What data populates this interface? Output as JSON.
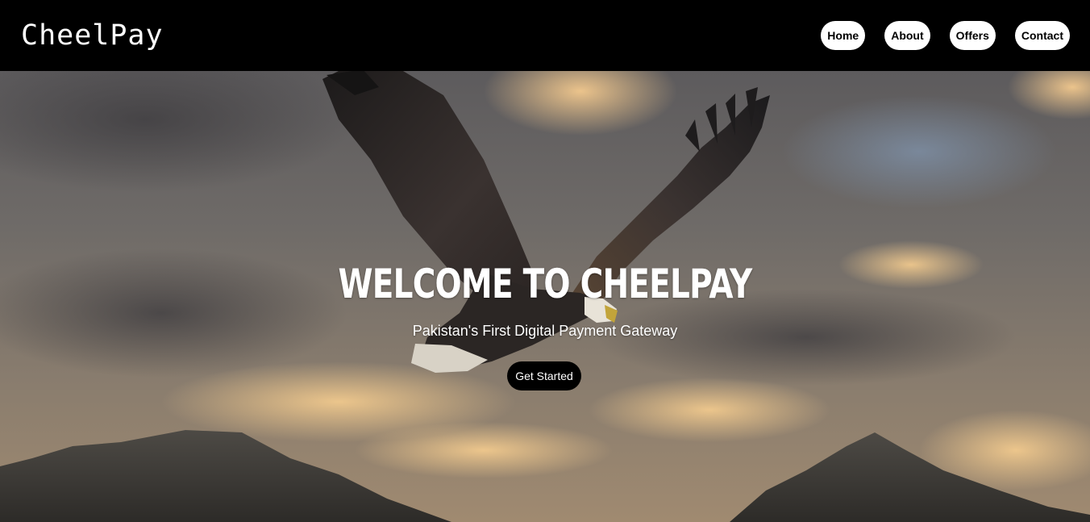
{
  "header": {
    "brand": "CheelPay",
    "nav": [
      {
        "label": "Home"
      },
      {
        "label": "About"
      },
      {
        "label": "Offers"
      },
      {
        "label": "Contact"
      }
    ]
  },
  "hero": {
    "title": "WELCOME TO CHEELPAY",
    "subtitle": "Pakistan's First Digital Payment Gateway",
    "cta_label": "Get Started",
    "background_image": "eagle-flying-over-mountains-image"
  },
  "colors": {
    "navbar_bg": "#000000",
    "nav_pill_bg": "#ffffff",
    "cta_bg": "#000000",
    "text_light": "#ffffff"
  }
}
